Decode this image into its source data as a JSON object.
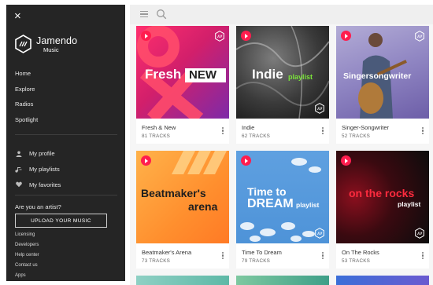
{
  "sidebar": {
    "close_label": "×",
    "logo_name": "Jamendo",
    "logo_sub": "Music",
    "nav": [
      "Home",
      "Explore",
      "Radios",
      "Spotlight"
    ],
    "user_nav": [
      {
        "label": "My profile",
        "icon": "person-icon"
      },
      {
        "label": "My playlists",
        "icon": "playlist-icon"
      },
      {
        "label": "My favorites",
        "icon": "heart-icon"
      }
    ],
    "artist_question": "Are you an artist?",
    "upload_label": "UPLOAD YOUR MUSIC",
    "footer_links": [
      "Licensing",
      "Developers",
      "Help center",
      "Contact us",
      "Apps"
    ]
  },
  "topbar": {
    "menu_icon": "hamburger-icon",
    "search_icon": "search-icon"
  },
  "playlists": [
    {
      "name": "Fresh & New",
      "count": "81",
      "unit": "TRACKS",
      "cover": {
        "line1": "Fresh",
        "line2": "NEW"
      }
    },
    {
      "name": "Indie",
      "count": "62",
      "unit": "TRACKS",
      "cover": {
        "line1": "Indie",
        "line2": "playlist"
      }
    },
    {
      "name": "Singer-Songwriter",
      "count": "52",
      "unit": "TRACKS",
      "cover": {
        "line1": "Singersong",
        "line2": "writer"
      }
    },
    {
      "name": "Beatmaker's Arena",
      "count": "73",
      "unit": "TRACKS",
      "cover": {
        "line1": "Beatmaker's",
        "line2": "arena"
      }
    },
    {
      "name": "Time To Dream",
      "count": "79",
      "unit": "TRACKS",
      "cover": {
        "line1": "Time to",
        "line2": "DREAM",
        "line3": "playlist"
      }
    },
    {
      "name": "On The Rocks",
      "count": "53",
      "unit": "TRACKS",
      "cover": {
        "line1": "on the rocks",
        "line2": "playlist"
      }
    }
  ],
  "colors": {
    "accent": "#ff1d4e",
    "sidebar_bg": "#252525",
    "topbar_bg": "#efefef"
  }
}
